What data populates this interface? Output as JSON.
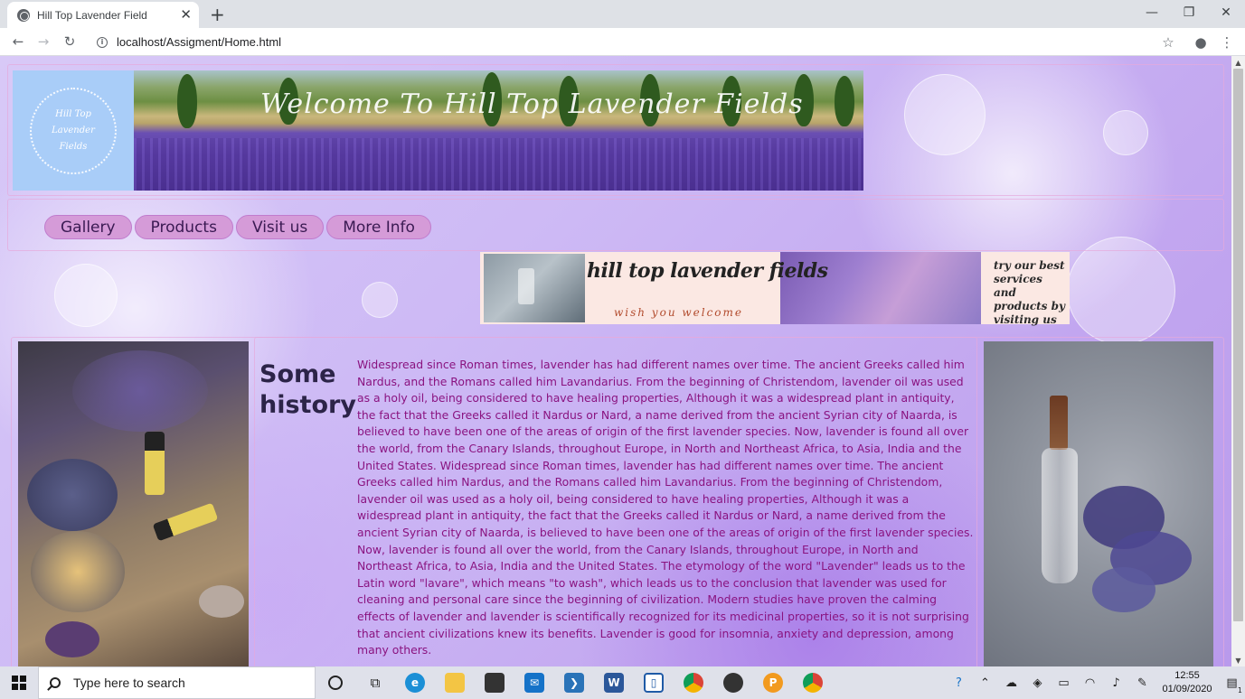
{
  "browser": {
    "tab_title": "Hill Top Lavender Field",
    "tab_close": "✕",
    "new_tab": "+",
    "url": "localhost/Assigment/Home.html",
    "window_controls": {
      "minimize": "—",
      "maximize": "❐",
      "close": "✕"
    }
  },
  "page": {
    "logo_text": "Hill Top Lavender Fields",
    "banner_text": "Welcome To Hill Top Lavender Fields",
    "nav": [
      "Gallery",
      "Products",
      "Visit us",
      "More Info"
    ],
    "promo": {
      "brand": "hill top lavender fields",
      "tagline": "wish you welcome",
      "call_to_action": "try our best services and products by visiting us"
    },
    "section_title": "Some history",
    "history_text": "Widespread since Roman times, lavender has had different names over time. The ancient Greeks called him Nardus, and the Romans called him Lavandarius. From the beginning of Christendom, lavender oil was used as a holy oil, being considered to have healing properties, Although it was a widespread plant in antiquity, the fact that the Greeks called it Nardus or Nard, a name derived from the ancient Syrian city of Naarda, is believed to have been one of the areas of origin of the first lavender species. Now, lavender is found all over the world, from the Canary Islands, throughout Europe, in North and Northeast Africa, to Asia, India and the United States. Widespread since Roman times, lavender has had different names over time. The ancient Greeks called him Nardus, and the Romans called him Lavandarius. From the beginning of Christendom, lavender oil was used as a holy oil, being considered to have healing properties, Although it was a widespread plant in antiquity, the fact that the Greeks called it Nardus or Nard, a name derived from the ancient Syrian city of Naarda, is believed to have been one of the areas of origin of the first lavender species. Now, lavender is found all over the world, from the Canary Islands, throughout Europe, in North and Northeast Africa, to Asia, India and the United States. The etymology of the word \"Lavender\" leads us to the Latin word \"lavare\", which means \"to wash\", which leads us to the conclusion that lavender was used for cleaning and personal care since the beginning of civilization. Modern studies have proven the calming effects of lavender and lavender is scientifically recognized for its medicinal properties, so it is not surprising that ancient civilizations knew its benefits. Lavender is good for insomnia, anxiety and depression, among many others."
  },
  "taskbar": {
    "search_placeholder": "Type here to search",
    "time": "12:55",
    "date": "01/09/2020",
    "notification_count": "1",
    "icons": [
      "cortana-icon",
      "task-view-icon",
      "edge-icon",
      "file-explorer-icon",
      "store-icon",
      "mail-icon",
      "powershell-icon",
      "word-icon",
      "app-icon",
      "chrome-icon",
      "github-icon",
      "app-orange-icon",
      "chrome-icon"
    ]
  },
  "colors": {
    "accent_nav": "#d59bd8",
    "history_text": "#8a1380",
    "title_text": "#2c2448"
  }
}
